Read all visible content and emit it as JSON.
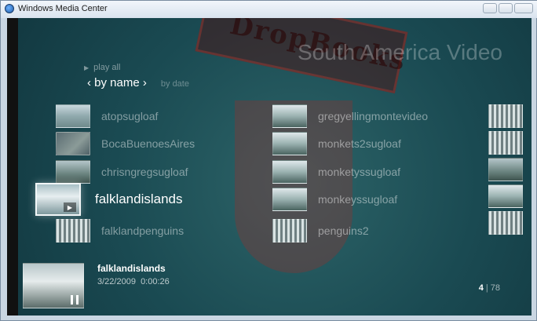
{
  "window": {
    "title": "Windows Media Center"
  },
  "watermark": {
    "text": "DropBooks"
  },
  "header": {
    "title": "South America Video"
  },
  "actions": {
    "play_all": "play all"
  },
  "sort": {
    "current": "by name",
    "alt": "by date"
  },
  "columns": [
    {
      "items": [
        {
          "label": "atopsugloaf",
          "thumb": "snow"
        },
        {
          "label": "BocaBuenoesAires",
          "thumb": "people"
        },
        {
          "label": "chrisngregsugloaf",
          "thumb": "hill"
        },
        {
          "label": "falklandislands",
          "thumb": "snow",
          "focused": true
        },
        {
          "label": "falklandpenguins",
          "thumb": "penguin"
        }
      ]
    },
    {
      "items": [
        {
          "label": "gregyellingmontevideo",
          "thumb": "tree"
        },
        {
          "label": "monkets2sugloaf",
          "thumb": "tree"
        },
        {
          "label": "monketyssugloaf",
          "thumb": "tree"
        },
        {
          "label": "monkeyssugloaf",
          "thumb": "tree"
        },
        {
          "label": "penguins2",
          "thumb": "penguin"
        }
      ]
    },
    {
      "items": [
        {
          "thumb": "penguin"
        },
        {
          "thumb": "penguin"
        },
        {
          "thumb": "hill"
        },
        {
          "thumb": "tree"
        },
        {
          "thumb": "penguin"
        }
      ]
    }
  ],
  "details": {
    "name": "falklandislands",
    "date": "3/22/2009",
    "duration": "0:00:26"
  },
  "pager": {
    "current": "4",
    "total": "78"
  }
}
